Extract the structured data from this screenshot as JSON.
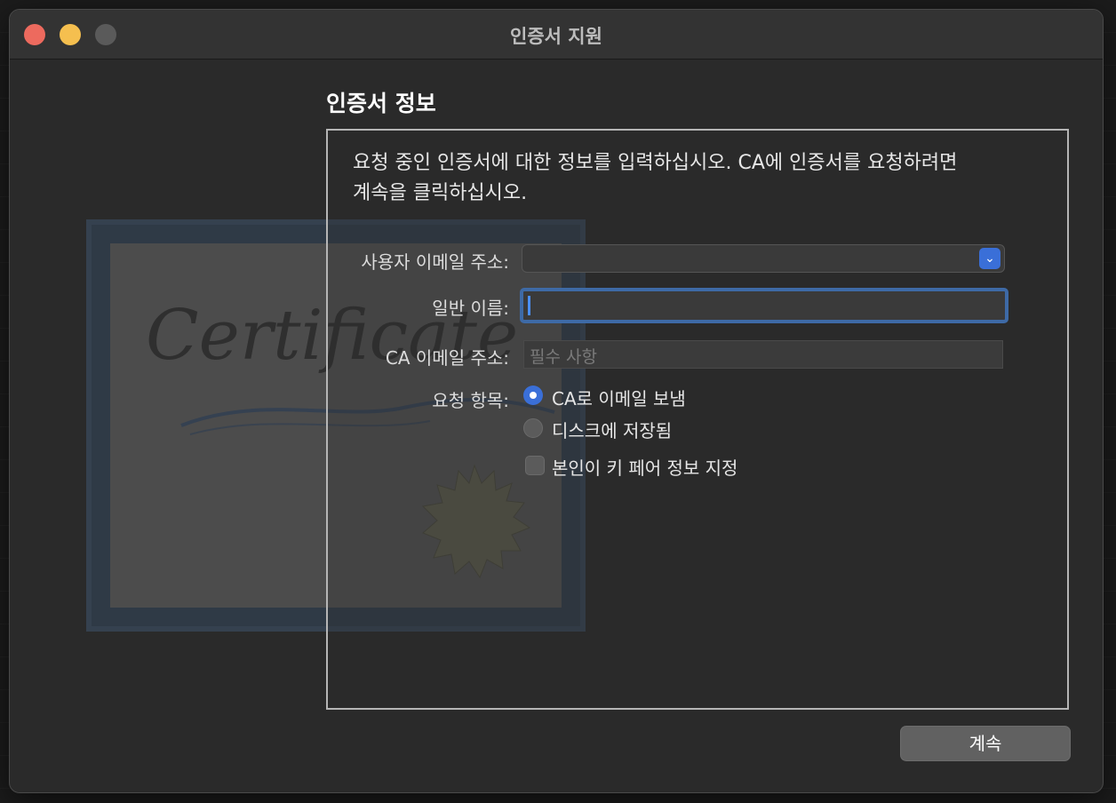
{
  "window": {
    "title": "인증서 지원"
  },
  "heading": "인증서 정보",
  "intro": {
    "line1": "요청 중인 인증서에 대한 정보를 입력하십시오. CA에 인증서를 요청하려면",
    "line2": "계속을 클릭하십시오."
  },
  "form": {
    "user_email_label": "사용자 이메일 주소:",
    "user_email_value": "",
    "common_name_label": "일반 이름:",
    "common_name_value": "",
    "ca_email_label": "CA 이메일 주소:",
    "ca_email_placeholder": "필수 사항",
    "request_label": "요청 항목:",
    "options": [
      {
        "label": "CA로 이메일 보냄",
        "selected": true
      },
      {
        "label": "디스크에 저장됨",
        "selected": false
      }
    ],
    "key_pair_label": "본인이 키 페어 정보 지정",
    "key_pair_checked": false
  },
  "artwork": {
    "cert_text": "Certificate"
  },
  "buttons": {
    "continue": "계속"
  },
  "colors": {
    "accent": "#3a6fd8",
    "window_bg": "#2a2a2a",
    "close": "#ed6a5e",
    "minimize": "#f5bf4f",
    "zoom": "#5a5a5a"
  }
}
